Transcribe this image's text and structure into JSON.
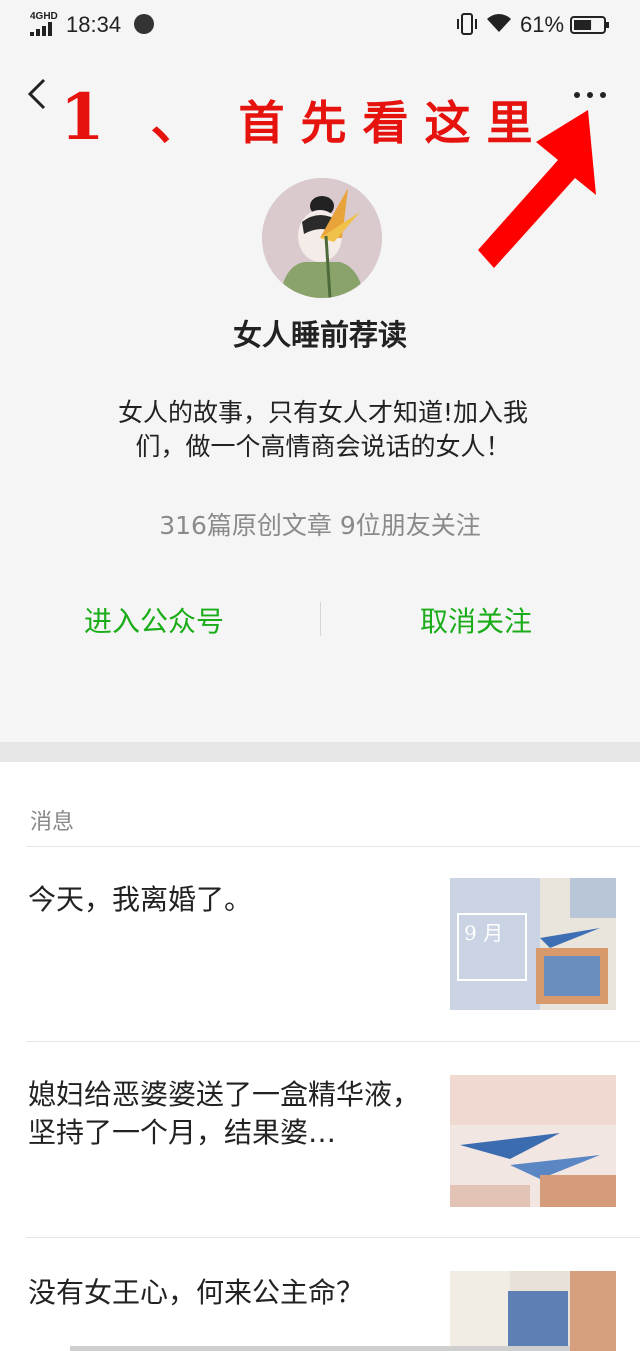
{
  "status_bar": {
    "network": "4GHD",
    "time": "18:34",
    "battery_percent": "61%",
    "battery_level": 0.61
  },
  "annotation": {
    "number": "1",
    "separator": "、",
    "text": "首先看这里"
  },
  "profile": {
    "name": "女人睡前荐读",
    "bio": "女人的故事，只有女人才知道!加入我们，做一个高情商会说话的女人！",
    "stats": "316篇原创文章  9位朋友关注"
  },
  "actions": {
    "enter_label": "进入公众号",
    "unfollow_label": "取消关注"
  },
  "messages": {
    "header": "消息",
    "items": [
      {
        "title": "今天，我离婚了。"
      },
      {
        "title": "媳妇给恶婆婆送了一盒精华液，坚持了一个月，结果婆…"
      },
      {
        "title": "没有女王心，何来公主命？"
      }
    ]
  },
  "colors": {
    "accent_green": "#1aad19",
    "annotation_red": "#e6120e"
  },
  "icons": [
    "back-arrow-icon",
    "more-dots-icon",
    "signal-icon",
    "wifi-icon",
    "vibrate-icon",
    "battery-icon"
  ]
}
